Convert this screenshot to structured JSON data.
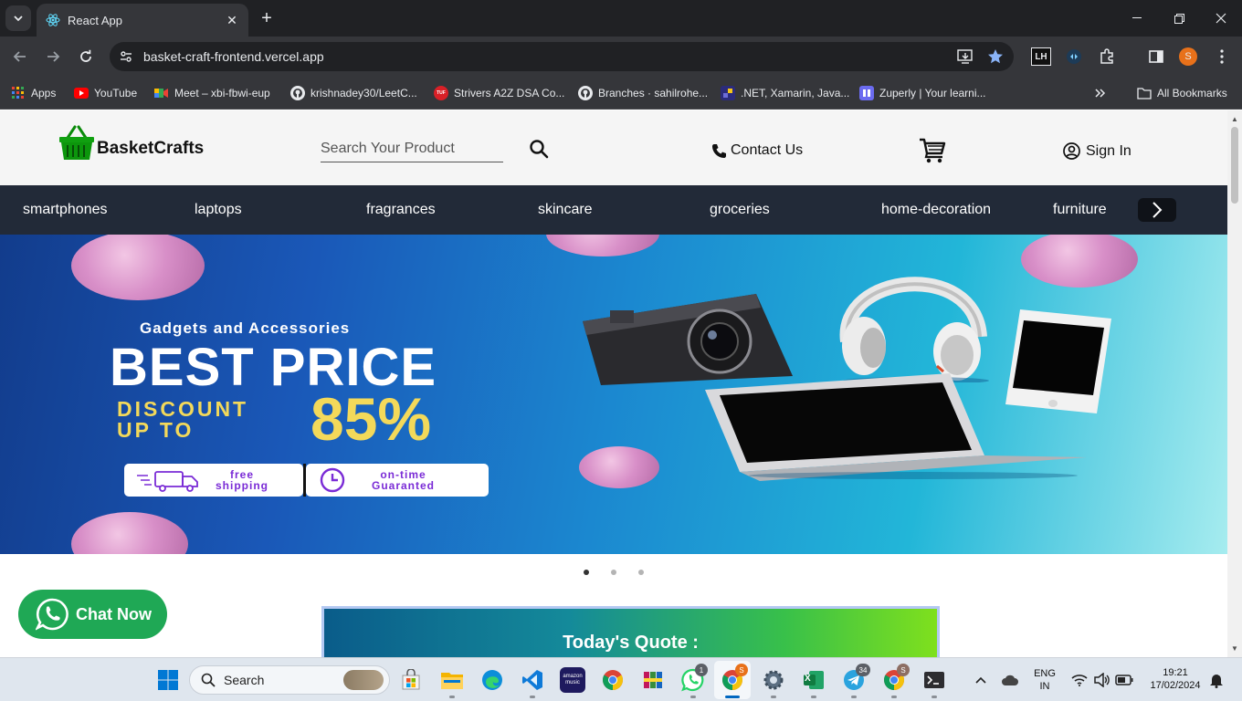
{
  "browser": {
    "tab_title": "React App",
    "url": "basket-craft-frontend.vercel.app",
    "profile_initial": "S",
    "bookmarks": [
      {
        "label": "Apps"
      },
      {
        "label": "YouTube"
      },
      {
        "label": "Meet – xbi-fbwi-eup"
      },
      {
        "label": "krishnadey30/LeetC..."
      },
      {
        "label": "Strivers A2Z DSA Co..."
      },
      {
        "label": "Branches · sahilrohe..."
      },
      {
        "label": ".NET, Xamarin, Java..."
      },
      {
        "label": "Zuperly | Your learni..."
      }
    ],
    "all_bookmarks": "All Bookmarks",
    "ext_lh": "LH",
    "tuf_icon_text": "TUF"
  },
  "site": {
    "brand": "BasketCrafts",
    "search_placeholder": "Search Your Product",
    "contact_label": "Contact Us",
    "signin_label": "Sign In",
    "categories": [
      "smartphones",
      "laptops",
      "fragrances",
      "skincare",
      "groceries",
      "home-decoration",
      "furniture"
    ],
    "hero": {
      "subtitle": "Gadgets and Accessories",
      "title": "BEST PRICE",
      "discount_line1": "DISCOUNT",
      "discount_line2": "UP TO",
      "percent": "85%",
      "badge1_line1": "free",
      "badge1_line2": "shipping",
      "badge2_line1": "on-time",
      "badge2_line2": "Guaranted"
    },
    "carousel": {
      "count": 3,
      "active": 0
    },
    "chat_label": "Chat Now",
    "quote_title": "Today's Quote :",
    "colors": {
      "nav_bar": "#222a38",
      "header_bg": "#f5f5f5",
      "chat_green": "#1fa855",
      "accent_yellow": "#f3d95a",
      "badge_purple": "#7a2bd6"
    }
  },
  "taskbar": {
    "search_label": "Search",
    "whatsapp_badge": "1",
    "chrome_badge": "S",
    "telegram_badge": "34",
    "chrome2_badge": "S",
    "amazon_music_label": "amazon music",
    "excel_letter": "X",
    "lang_line1": "ENG",
    "lang_line2": "IN",
    "time": "19:21",
    "date": "17/02/2024"
  }
}
